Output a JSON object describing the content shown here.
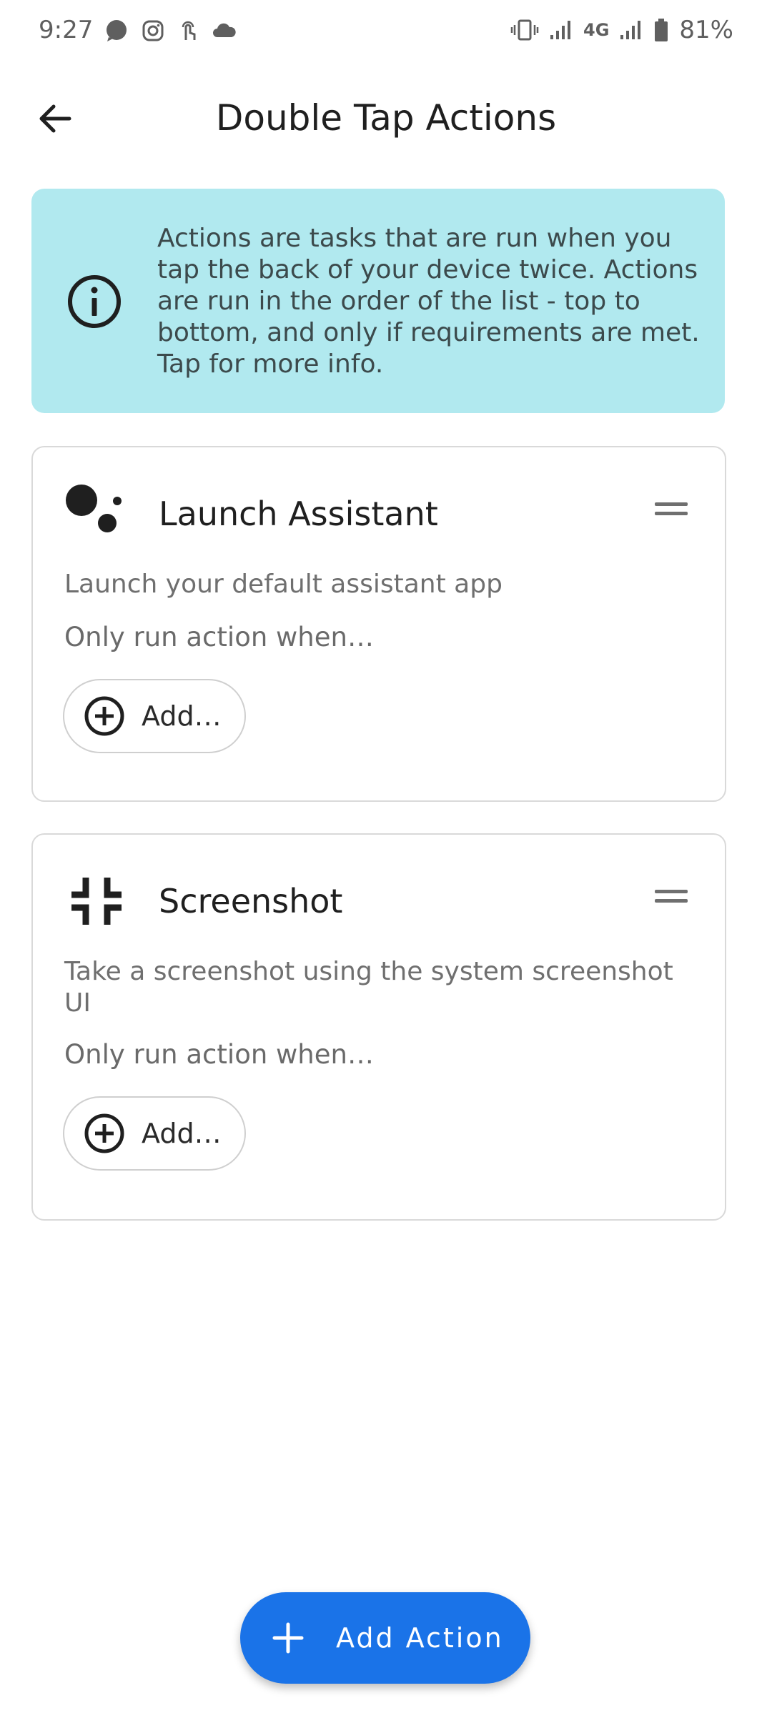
{
  "status_bar": {
    "time": "9:27",
    "network": "4G",
    "battery": "81%",
    "notification_icons": [
      "chat-bubble-icon",
      "instagram-icon",
      "touch-icon",
      "cloud-icon"
    ]
  },
  "toolbar": {
    "title": "Double Tap Actions"
  },
  "info_banner": {
    "text": "Actions are tasks that are run when you tap the back of your device twice. Actions are run in the order of the list - top to bottom, and only if requirements are met. Tap for more info."
  },
  "actions": [
    {
      "icon": "assistant-dots-icon",
      "title": "Launch Assistant",
      "description": "Launch your default assistant app",
      "condition_label": "Only run action when…",
      "add_label": "Add…"
    },
    {
      "icon": "screenshot-corners-icon",
      "title": "Screenshot",
      "description": "Take a screenshot using the system screenshot UI",
      "condition_label": "Only run action when…",
      "add_label": "Add…"
    }
  ],
  "fab": {
    "label": "Add Action"
  },
  "colors": {
    "banner_bg": "#b1e9ef",
    "fab_bg": "#1a73e8",
    "card_border": "#d9d9d9"
  }
}
